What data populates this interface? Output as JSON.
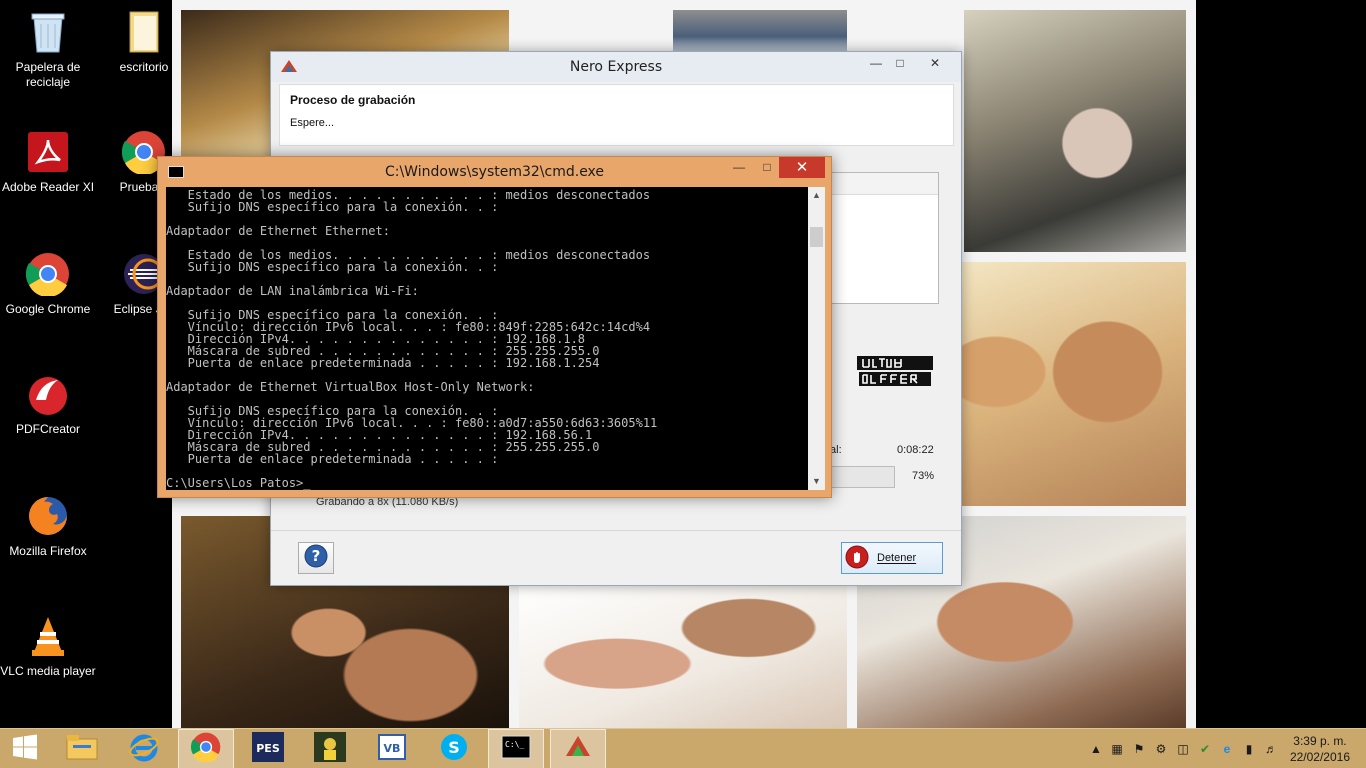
{
  "desktop": {
    "icons": [
      {
        "label": "Papelera de\nreciclaje",
        "icon": "recycle-bin-icon"
      },
      {
        "label": "escritorio",
        "icon": "folder-icon"
      },
      {
        "label": "Adobe Reader XI",
        "icon": "adobe-reader-icon"
      },
      {
        "label": "Prueba.h",
        "icon": "chrome-icon"
      },
      {
        "label": "Google Chrome",
        "icon": "chrome-icon"
      },
      {
        "label": "Eclipse Jav",
        "icon": "eclipse-icon"
      },
      {
        "label": "PDFCreator",
        "icon": "pdfcreator-icon"
      },
      {
        "label": "Mozilla Firefox",
        "icon": "firefox-icon"
      },
      {
        "label": "VLC media player",
        "icon": "vlc-icon"
      }
    ]
  },
  "nero": {
    "title": "Nero Express",
    "section_title": "Proceso de grabación",
    "status": "Espere...",
    "time_label": "tal:",
    "time_value": "0:08:22",
    "progress_percent": "73%",
    "progress_value": 0.73,
    "speed": "Grabando a 8x (11.080 KB/s)",
    "stop_label": "Detener",
    "help_icon": "help-icon",
    "logo": "ultra-buffer-logo"
  },
  "cmd": {
    "title": "C:\\Windows\\system32\\cmd.exe",
    "lines": [
      "   Estado de los medios. . . . . . . . . . . : medios desconectados",
      "   Sufijo DNS específico para la conexión. . :",
      "",
      "Adaptador de Ethernet Ethernet:",
      "",
      "   Estado de los medios. . . . . . . . . . . : medios desconectados",
      "   Sufijo DNS específico para la conexión. . :",
      "",
      "Adaptador de LAN inalámbrica Wi-Fi:",
      "",
      "   Sufijo DNS específico para la conexión. . :",
      "   Vínculo: dirección IPv6 local. . . : fe80::849f:2285:642c:14cd%4",
      "   Dirección IPv4. . . . . . . . . . . . . . : 192.168.1.8",
      "   Máscara de subred . . . . . . . . . . . . : 255.255.255.0",
      "   Puerta de enlace predeterminada . . . . . : 192.168.1.254",
      "",
      "Adaptador de Ethernet VirtualBox Host-Only Network:",
      "",
      "   Sufijo DNS específico para la conexión. . :",
      "   Vínculo: dirección IPv6 local. . . : fe80::a0d7:a550:6d63:3605%11",
      "   Dirección IPv4. . . . . . . . . . . . . . : 192.168.56.1",
      "   Máscara de subred . . . . . . . . . . . . : 255.255.255.0",
      "   Puerta de enlace predeterminada . . . . . :",
      "",
      "C:\\Users\\Los Patos>_"
    ]
  },
  "taskbar": {
    "items": [
      "start-icon",
      "file-explorer-icon",
      "internet-explorer-icon",
      "chrome-icon",
      "pes-game-icon",
      "soccer-game-icon",
      "virtualbox-icon",
      "skype-icon",
      "cmd-icon",
      "nero-icon"
    ],
    "clock_time": "3:39 p. m.",
    "clock_date": "22/02/2016"
  },
  "colors": {
    "taskbar": "#caa76b",
    "cmd_frame": "#e9a66a",
    "close_red": "#c7392b",
    "nero_accent": "#5a9cd6"
  }
}
